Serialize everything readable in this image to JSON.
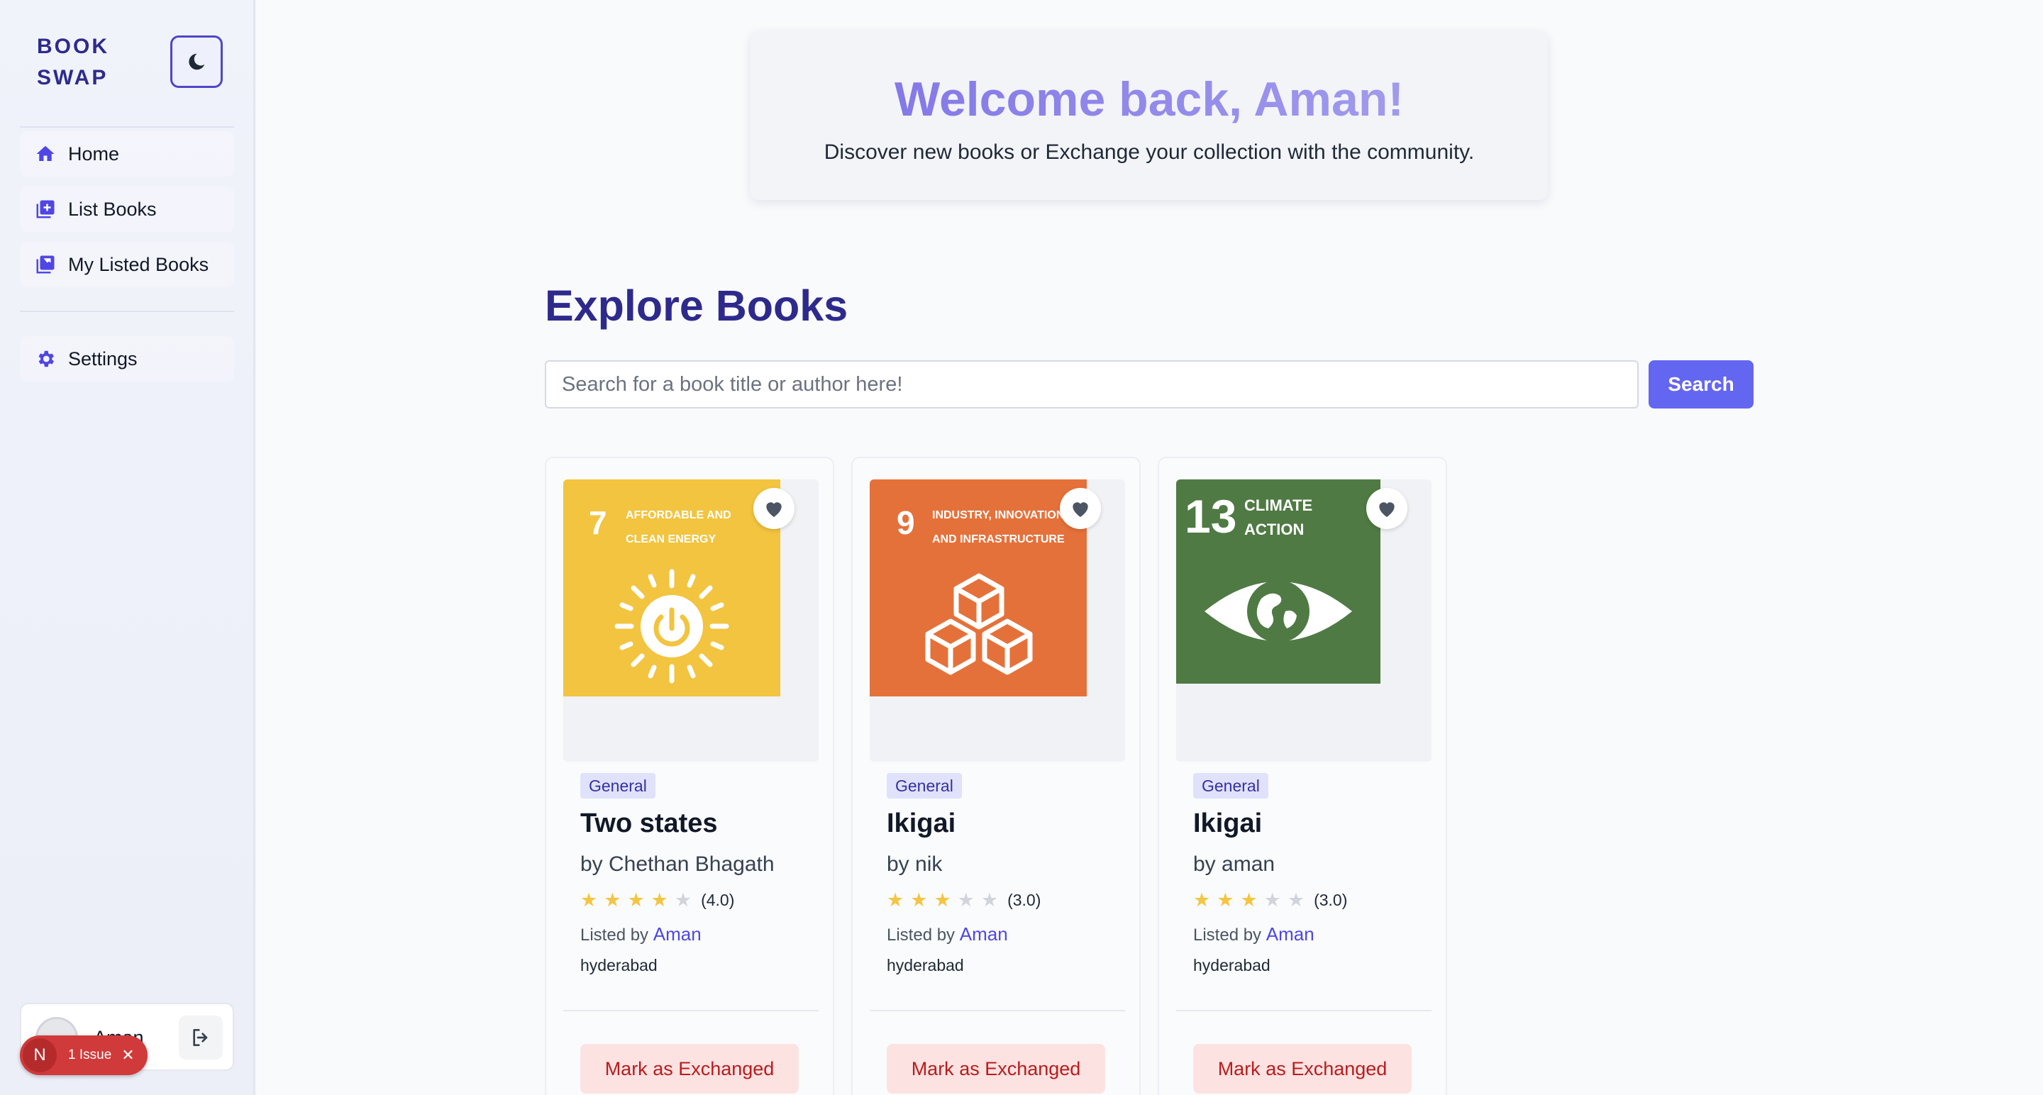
{
  "brand": {
    "line1": "BOOK",
    "line2": "SWAP"
  },
  "sidebar": {
    "items": [
      {
        "label": "Home",
        "icon": "home-icon"
      },
      {
        "label": "List Books",
        "icon": "add-box-icon"
      },
      {
        "label": "My Listed Books",
        "icon": "library-icon"
      },
      {
        "label": "Settings",
        "icon": "gear-icon"
      }
    ],
    "user": {
      "name": "Aman"
    }
  },
  "issue": {
    "letter": "N",
    "label": "1 Issue"
  },
  "welcome": {
    "title": "Welcome back, Aman!",
    "subtitle": "Discover new books or Exchange your collection with the community."
  },
  "explore": {
    "title": "Explore Books",
    "search_placeholder": "Search for a book title or author here!",
    "search_button": "Search"
  },
  "colors": {
    "accent": "#6366f1",
    "brand": "#2e2a8c",
    "sdg7": "#f2c43f",
    "sdg9": "#e5713a",
    "sdg13": "#4f7a44"
  },
  "books": [
    {
      "genre": "General",
      "title": "Two states",
      "author": "by Chethan Bhagath",
      "rating": 4,
      "rating_text": "(4.0)",
      "listed_prefix": "Listed by",
      "listed_by": "Aman",
      "location": "hyderabad",
      "action": "Mark as Exchanged",
      "cover": {
        "num": "7",
        "caption1": "AFFORDABLE AND",
        "caption2": "CLEAN ENERGY",
        "color": "#f2c43f"
      }
    },
    {
      "genre": "General",
      "title": "Ikigai",
      "author": "by nik",
      "rating": 3,
      "rating_text": "(3.0)",
      "listed_prefix": "Listed by",
      "listed_by": "Aman",
      "location": "hyderabad",
      "action": "Mark as Exchanged",
      "cover": {
        "num": "9",
        "caption1": "INDUSTRY, INNOVATION",
        "caption2": "AND INFRASTRUCTURE",
        "color": "#e5713a"
      }
    },
    {
      "genre": "General",
      "title": "Ikigai",
      "author": "by aman",
      "rating": 3,
      "rating_text": "(3.0)",
      "listed_prefix": "Listed by",
      "listed_by": "Aman",
      "location": "hyderabad",
      "action": "Mark as Exchanged",
      "cover": {
        "num": "13",
        "caption1": "CLIMATE",
        "caption2": "ACTION",
        "color": "#4f7a44"
      }
    }
  ]
}
